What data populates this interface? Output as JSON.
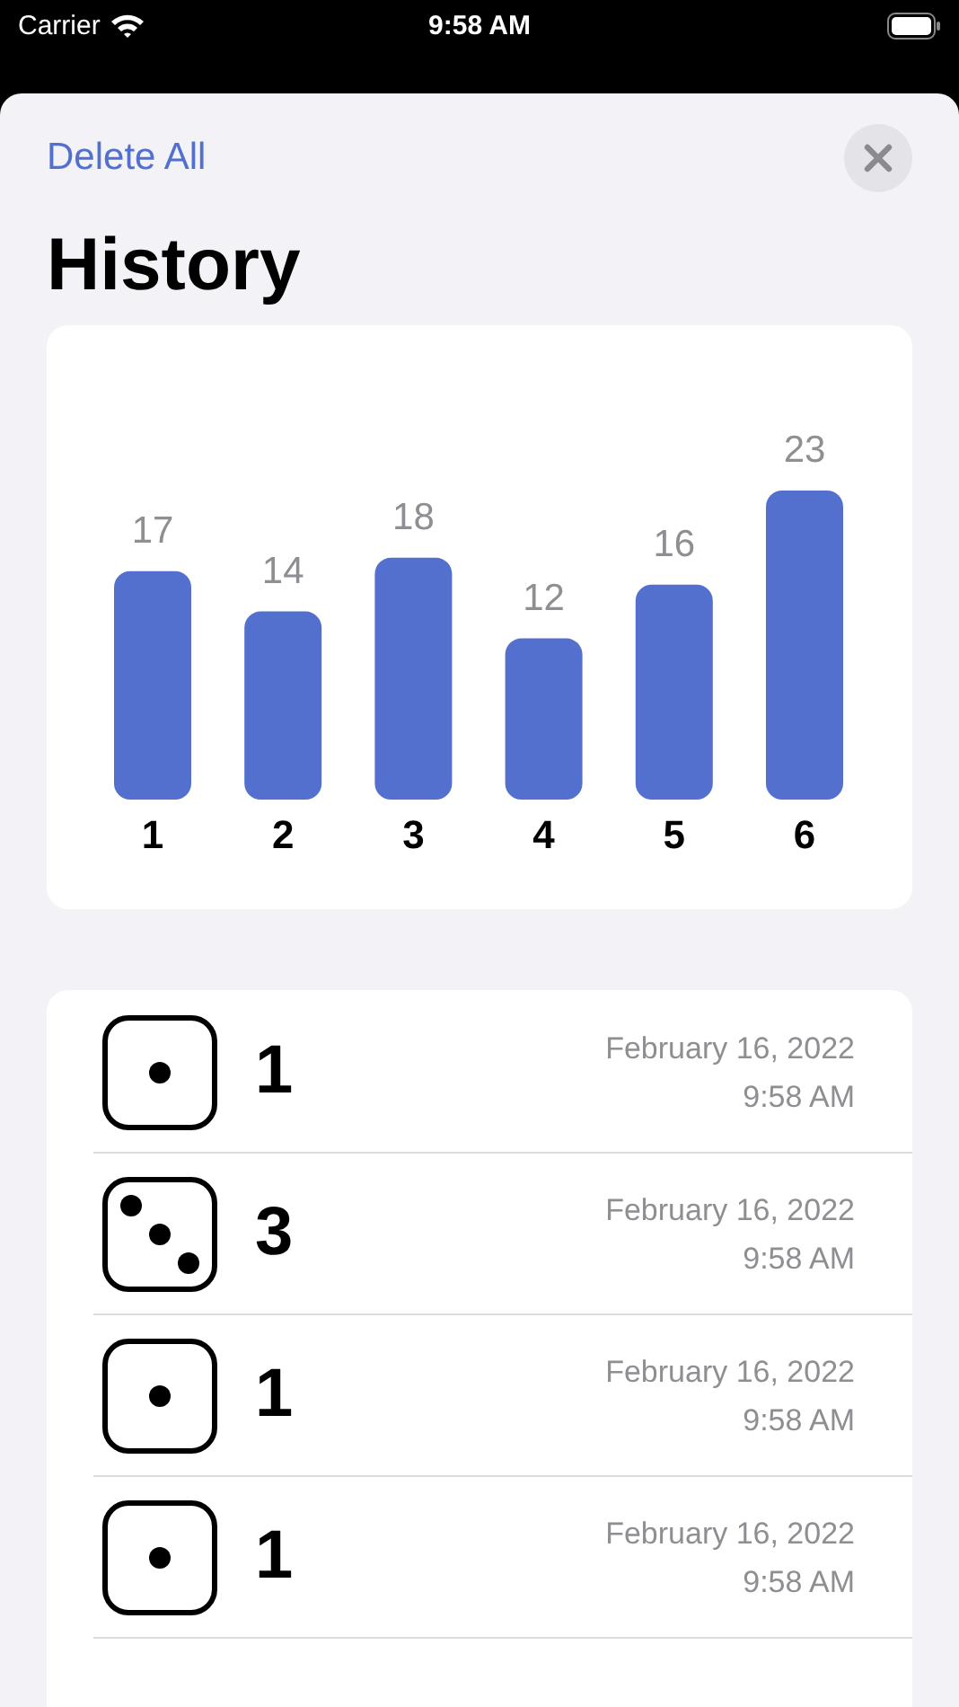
{
  "status_bar": {
    "carrier": "Carrier",
    "time": "9:58 AM"
  },
  "header": {
    "action": "Delete All"
  },
  "title": "History",
  "chart": {
    "chart_data": {
      "type": "bar",
      "categories": [
        "1",
        "2",
        "3",
        "4",
        "5",
        "6"
      ],
      "values": [
        17,
        14,
        18,
        12,
        16,
        23
      ],
      "data_labels": true
    }
  },
  "rolls": [
    {
      "kind": "one",
      "value": "1",
      "date": "February 16, 2022",
      "time": "9:58 AM"
    },
    {
      "kind": "three",
      "value": "3",
      "date": "February 16, 2022",
      "time": "9:58 AM"
    },
    {
      "kind": "one",
      "value": "1",
      "date": "February 16, 2022",
      "time": "9:58 AM"
    },
    {
      "kind": "one",
      "value": "1",
      "date": "February 16, 2022",
      "time": "9:58 AM"
    }
  ]
}
